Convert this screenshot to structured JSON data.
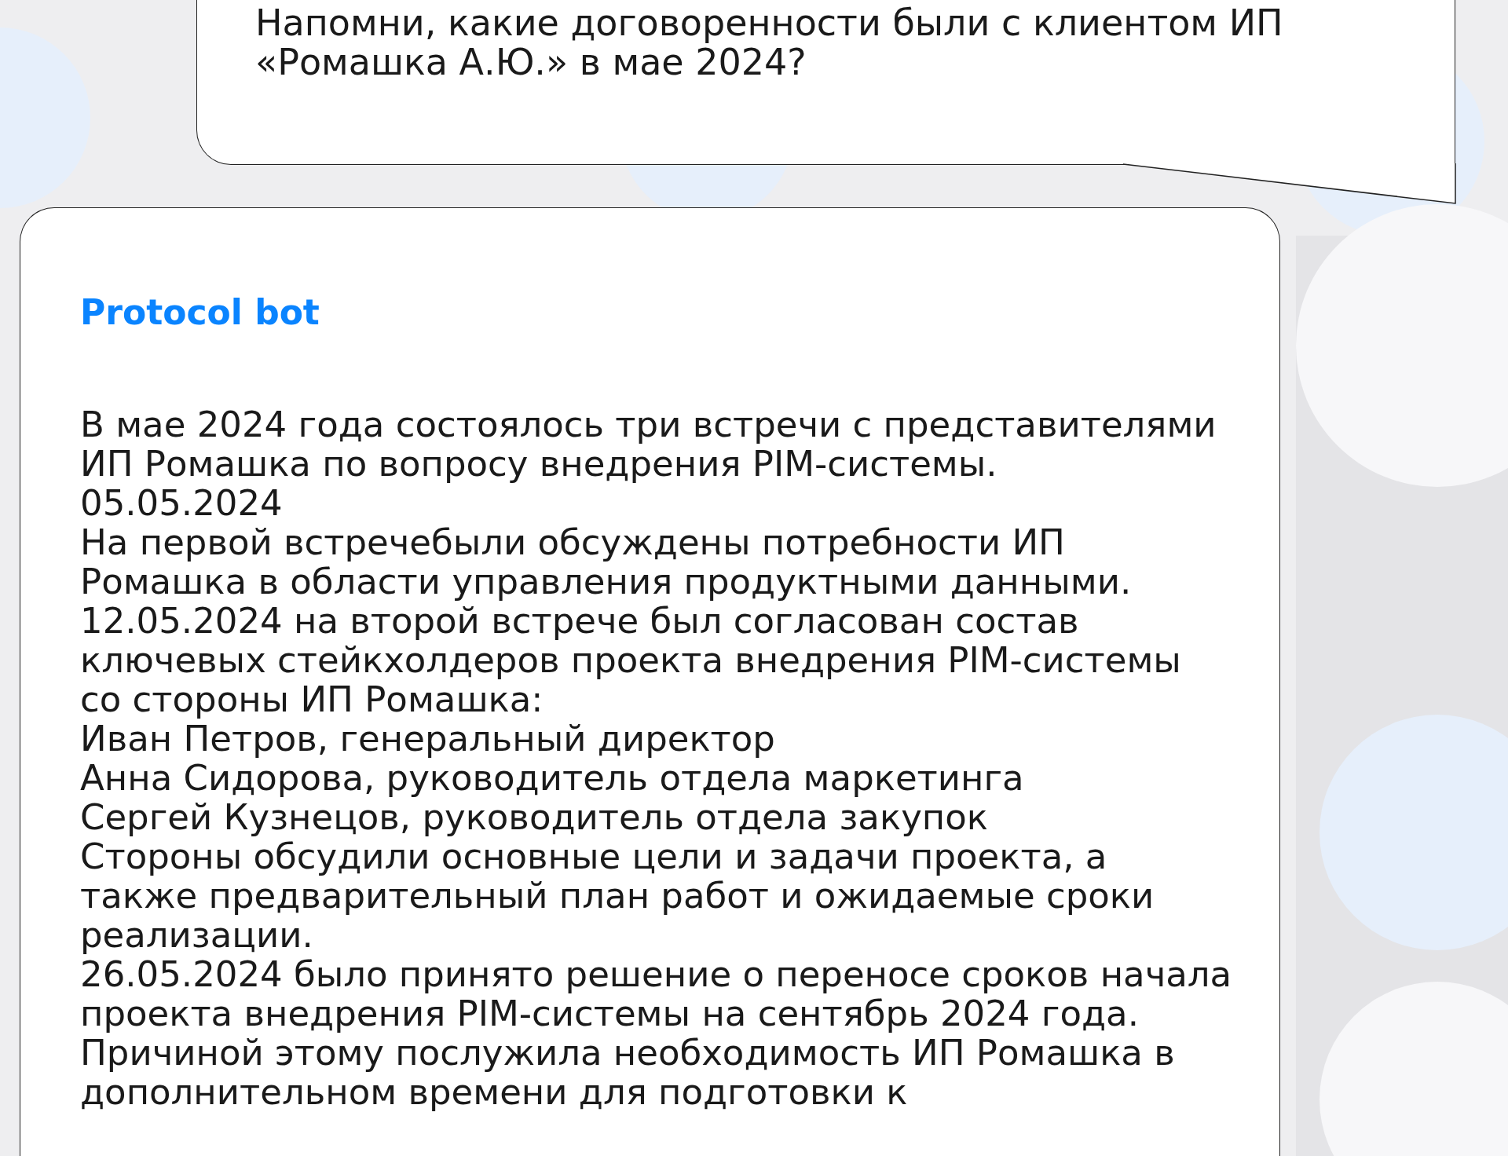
{
  "user_message": {
    "text": "Напомни, какие договоренности были с клиентом ИП «Ромашка А.Ю.» в мае 2024?"
  },
  "bot_message": {
    "sender": "Protocol bot",
    "paragraphs": [
      "В мае 2024 года состоялось три встречи с представителями ИП Ромашка по вопросу внедрения PIM-системы.",
      "05.05.2024",
      "На первой встречебыли обсуждены потребности ИП Ромашка в области управления продуктными данными.",
      "12.05.2024 на второй встрече был согласован состав ключевых стейкхолдеров проекта внедрения PIM-системы со стороны ИП Ромашка:",
      "Иван Петров, генеральный директор",
      "Анна Сидорова, руководитель отдела маркетинга",
      "Сергей Кузнецов, руководитель отдела закупок",
      "Стороны обсудили основные цели и задачи проекта, а также предварительный план работ и ожидаемые сроки реализации.",
      "26.05.2024 было принято решение о переносе сроков начала проекта внедрения PIM-системы на сентябрь 2024 года. Причиной этому послужила необходимость ИП Ромашка в дополнительном времени для подготовки к"
    ]
  }
}
